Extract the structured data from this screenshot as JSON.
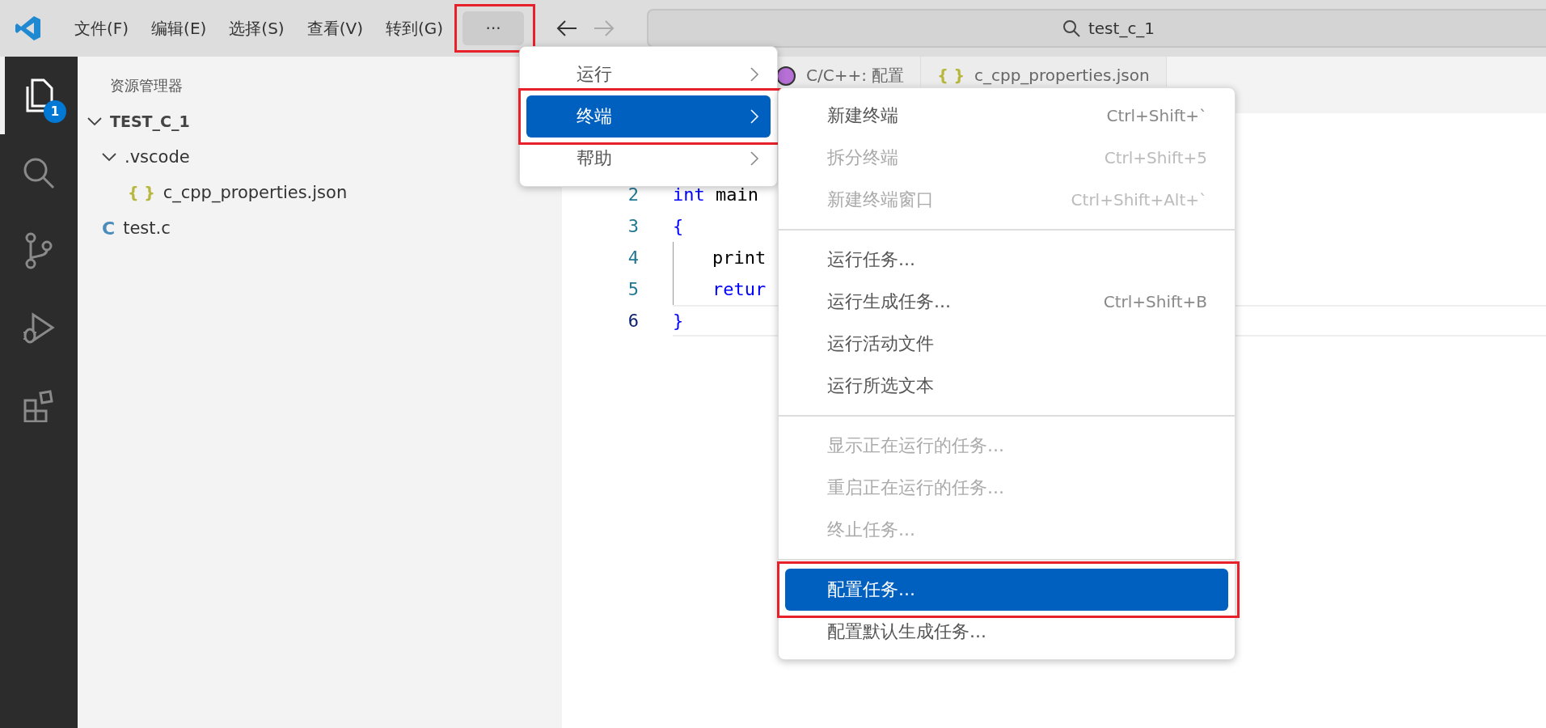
{
  "menubar": {
    "items": [
      {
        "label": "文件(F)"
      },
      {
        "label": "编辑(E)"
      },
      {
        "label": "选择(S)"
      },
      {
        "label": "查看(V)"
      },
      {
        "label": "转到(G)"
      }
    ],
    "more": {
      "label": "···",
      "selected": true,
      "annotated": true
    }
  },
  "search": {
    "value": "test_c_1"
  },
  "activity_bar": {
    "items": [
      {
        "kind": "files",
        "selected": true,
        "badge": "1"
      },
      {
        "kind": "search",
        "selected": false
      },
      {
        "kind": "source_control",
        "selected": false
      },
      {
        "kind": "run_debug",
        "selected": false
      },
      {
        "kind": "extensions",
        "selected": false
      }
    ]
  },
  "sidebar": {
    "title": "资源管理器",
    "tree": [
      {
        "label": "TEST_C_1",
        "kind": "folder",
        "expanded": true,
        "children": [
          {
            "label": ".vscode",
            "kind": "folder",
            "expanded": true,
            "children": [
              {
                "label": "c_cpp_properties.json",
                "kind": "json",
                "icon_text": "{ }"
              }
            ]
          },
          {
            "label": "test.c",
            "kind": "c",
            "icon_text": "C"
          }
        ]
      }
    ]
  },
  "tabs": [
    {
      "label": "C/C++: 配置",
      "kind": "cpp",
      "selected": false
    },
    {
      "label": "c_cpp_properties.json",
      "kind": "json",
      "icon_text": "{ }",
      "selected": false
    }
  ],
  "code": {
    "lines": [
      {
        "number": "2",
        "current": false,
        "tokens": [
          {
            "kind": "keyword",
            "text": "int"
          },
          {
            "kind": "plain",
            "text": " main"
          }
        ]
      },
      {
        "number": "3",
        "current": false,
        "tokens": [
          {
            "kind": "bracket",
            "text": "{"
          }
        ]
      },
      {
        "number": "4",
        "current": false,
        "indent": true,
        "tokens": [
          {
            "kind": "plain",
            "text": "print"
          }
        ]
      },
      {
        "number": "5",
        "current": false,
        "indent": true,
        "tokens": [
          {
            "kind": "keyword",
            "text": "retur"
          }
        ]
      },
      {
        "number": "6",
        "current": true,
        "tokens": [
          {
            "kind": "bracket",
            "text": "}"
          }
        ]
      }
    ]
  },
  "menu": {
    "items": [
      {
        "label": "运行",
        "selected": false,
        "annotated": false
      },
      {
        "label": "终端",
        "selected": true,
        "annotated": true
      },
      {
        "label": "帮助",
        "selected": false,
        "annotated": false
      }
    ]
  },
  "submenu": {
    "items": [
      {
        "kind": "item",
        "label": "新建终端",
        "shortcut": "Ctrl+Shift+`",
        "disabled": false,
        "selected": false,
        "annotated": false
      },
      {
        "kind": "item",
        "label": "拆分终端",
        "shortcut": "Ctrl+Shift+5",
        "disabled": true,
        "selected": false,
        "annotated": false
      },
      {
        "kind": "item",
        "label": "新建终端窗口",
        "shortcut": "Ctrl+Shift+Alt+`",
        "disabled": true,
        "selected": false,
        "annotated": false
      },
      {
        "kind": "separator"
      },
      {
        "kind": "item",
        "label": "运行任务...",
        "disabled": false,
        "selected": false,
        "annotated": false
      },
      {
        "kind": "item",
        "label": "运行生成任务...",
        "shortcut": "Ctrl+Shift+B",
        "disabled": false,
        "selected": false,
        "annotated": false
      },
      {
        "kind": "item",
        "label": "运行活动文件",
        "disabled": false,
        "selected": false,
        "annotated": false
      },
      {
        "kind": "item",
        "label": "运行所选文本",
        "disabled": false,
        "selected": false,
        "annotated": false
      },
      {
        "kind": "separator"
      },
      {
        "kind": "item",
        "label": "显示正在运行的任务...",
        "disabled": true,
        "selected": false,
        "annotated": false
      },
      {
        "kind": "item",
        "label": "重启正在运行的任务...",
        "disabled": true,
        "selected": false,
        "annotated": false
      },
      {
        "kind": "item",
        "label": "终止任务...",
        "disabled": true,
        "selected": false,
        "annotated": false
      },
      {
        "kind": "separator"
      },
      {
        "kind": "item",
        "label": "配置任务...",
        "disabled": false,
        "selected": true,
        "annotated": true
      },
      {
        "kind": "item",
        "label": "配置默认生成任务...",
        "disabled": false,
        "selected": false,
        "annotated": false
      }
    ]
  }
}
